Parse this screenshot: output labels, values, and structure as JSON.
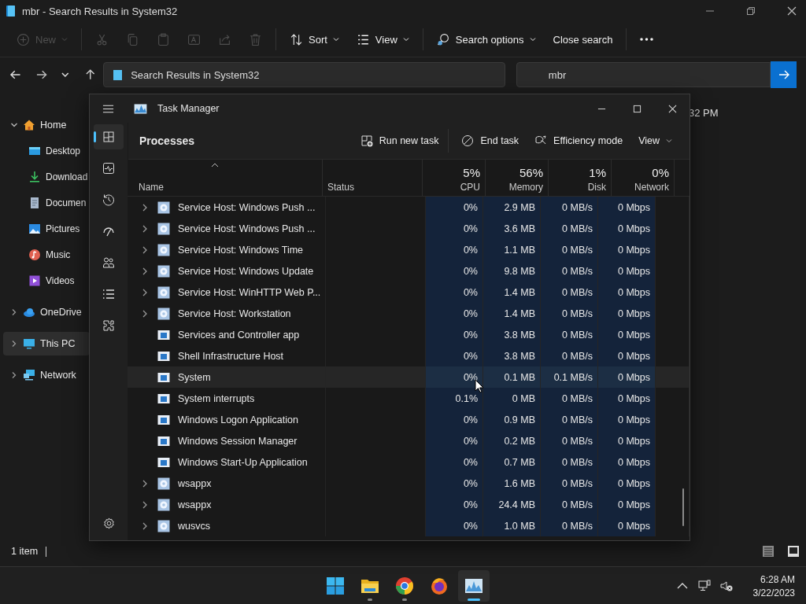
{
  "explorer": {
    "title": "mbr - Search Results in System32",
    "toolbar": [
      {
        "kind": "new",
        "label": "New",
        "disabled": true
      },
      {
        "kind": "cut",
        "disabled": true
      },
      {
        "kind": "copy",
        "disabled": true
      },
      {
        "kind": "paste",
        "disabled": true
      },
      {
        "kind": "rename",
        "disabled": true
      },
      {
        "kind": "share",
        "disabled": true
      },
      {
        "kind": "delete",
        "disabled": true
      },
      {
        "kind": "sort",
        "label": "Sort",
        "disabled": false
      },
      {
        "kind": "view",
        "label": "View",
        "disabled": false
      },
      {
        "kind": "search-options",
        "label": "Search options",
        "disabled": false
      },
      {
        "kind": "close-search",
        "label": "Close search",
        "disabled": false
      },
      {
        "kind": "more",
        "disabled": false
      }
    ],
    "address": "Search Results in System32",
    "search": {
      "value": "mbr"
    },
    "sidebar": [
      {
        "label": "Home",
        "kind": "home",
        "expanded": true,
        "selected": false,
        "children": [
          {
            "label": "Desktop",
            "kind": "desktop",
            "selected": false
          },
          {
            "label": "Download",
            "kind": "downloads",
            "selected": false
          },
          {
            "label": "Documen",
            "kind": "documents",
            "selected": false
          },
          {
            "label": "Pictures",
            "kind": "pictures",
            "selected": false
          },
          {
            "label": "Music",
            "kind": "music",
            "selected": false
          },
          {
            "label": "Videos",
            "kind": "videos",
            "selected": false
          }
        ]
      },
      {
        "label": "OneDrive",
        "kind": "cloud",
        "expanded": false,
        "selected": false
      },
      {
        "label": "This PC",
        "kind": "pc",
        "expanded": false,
        "selected": true
      },
      {
        "label": "Network",
        "kind": "network",
        "expanded": false,
        "selected": false
      }
    ],
    "results_fragment": "32 PM",
    "status": "1 item"
  },
  "task_manager": {
    "title": "Task Manager",
    "nav": [
      {
        "kind": "processes",
        "selected": true
      },
      {
        "kind": "performance",
        "selected": false
      },
      {
        "kind": "history",
        "selected": false
      },
      {
        "kind": "startup",
        "selected": false
      },
      {
        "kind": "users",
        "selected": false
      },
      {
        "kind": "details",
        "selected": false
      },
      {
        "kind": "services",
        "selected": false
      }
    ],
    "page_title": "Processes",
    "actions": [
      {
        "kind": "run",
        "label": "Run new task"
      },
      {
        "kind": "end",
        "label": "End task"
      },
      {
        "kind": "efficiency",
        "label": "Efficiency mode"
      },
      {
        "kind": "view",
        "label": "View"
      }
    ],
    "columns": [
      {
        "label": "Name"
      },
      {
        "label": "Status"
      },
      {
        "label": "CPU",
        "total": "5%"
      },
      {
        "label": "Memory",
        "total": "56%"
      },
      {
        "label": "Disk",
        "total": "1%"
      },
      {
        "label": "Network",
        "total": "0%"
      }
    ],
    "rows": [
      {
        "name": "Service Host: Windows Push ...",
        "kind": "service",
        "expandable": true,
        "selected": false,
        "cpu": "0%",
        "memory": "2.9 MB",
        "disk": "0 MB/s",
        "network": "0 Mbps"
      },
      {
        "name": "Service Host: Windows Push ...",
        "kind": "service",
        "expandable": true,
        "selected": false,
        "cpu": "0%",
        "memory": "3.6 MB",
        "disk": "0 MB/s",
        "network": "0 Mbps"
      },
      {
        "name": "Service Host: Windows Time",
        "kind": "service",
        "expandable": true,
        "selected": false,
        "cpu": "0%",
        "memory": "1.1 MB",
        "disk": "0 MB/s",
        "network": "0 Mbps"
      },
      {
        "name": "Service Host: Windows Update",
        "kind": "service",
        "expandable": true,
        "selected": false,
        "cpu": "0%",
        "memory": "9.8 MB",
        "disk": "0 MB/s",
        "network": "0 Mbps"
      },
      {
        "name": "Service Host: WinHTTP Web P...",
        "kind": "service",
        "expandable": true,
        "selected": false,
        "cpu": "0%",
        "memory": "1.4 MB",
        "disk": "0 MB/s",
        "network": "0 Mbps"
      },
      {
        "name": "Service Host: Workstation",
        "kind": "service",
        "expandable": true,
        "selected": false,
        "cpu": "0%",
        "memory": "1.4 MB",
        "disk": "0 MB/s",
        "network": "0 Mbps"
      },
      {
        "name": "Services and Controller app",
        "kind": "app",
        "expandable": false,
        "selected": false,
        "cpu": "0%",
        "memory": "3.8 MB",
        "disk": "0 MB/s",
        "network": "0 Mbps"
      },
      {
        "name": "Shell Infrastructure Host",
        "kind": "app",
        "expandable": false,
        "selected": false,
        "cpu": "0%",
        "memory": "3.8 MB",
        "disk": "0 MB/s",
        "network": "0 Mbps"
      },
      {
        "name": "System",
        "kind": "app",
        "expandable": false,
        "selected": true,
        "cpu": "0%",
        "memory": "0.1 MB",
        "disk": "0.1 MB/s",
        "network": "0 Mbps"
      },
      {
        "name": "System interrupts",
        "kind": "app",
        "expandable": false,
        "selected": false,
        "cpu": "0.1%",
        "memory": "0 MB",
        "disk": "0 MB/s",
        "network": "0 Mbps"
      },
      {
        "name": "Windows Logon Application",
        "kind": "app",
        "expandable": false,
        "selected": false,
        "cpu": "0%",
        "memory": "0.9 MB",
        "disk": "0 MB/s",
        "network": "0 Mbps"
      },
      {
        "name": "Windows Session Manager",
        "kind": "app",
        "expandable": false,
        "selected": false,
        "cpu": "0%",
        "memory": "0.2 MB",
        "disk": "0 MB/s",
        "network": "0 Mbps"
      },
      {
        "name": "Windows Start-Up Application",
        "kind": "app",
        "expandable": false,
        "selected": false,
        "cpu": "0%",
        "memory": "0.7 MB",
        "disk": "0 MB/s",
        "network": "0 Mbps"
      },
      {
        "name": "wsappx",
        "kind": "service",
        "expandable": true,
        "selected": false,
        "cpu": "0%",
        "memory": "1.6 MB",
        "disk": "0 MB/s",
        "network": "0 Mbps"
      },
      {
        "name": "wsappx",
        "kind": "service",
        "expandable": true,
        "selected": false,
        "cpu": "0%",
        "memory": "24.4 MB",
        "disk": "0 MB/s",
        "network": "0 Mbps"
      },
      {
        "name": "wusvcs",
        "kind": "service",
        "expandable": true,
        "selected": false,
        "cpu": "0%",
        "memory": "1.0 MB",
        "disk": "0 MB/s",
        "network": "0 Mbps"
      }
    ]
  },
  "taskbar": {
    "apps": [
      {
        "kind": "start",
        "running": false,
        "active": false
      },
      {
        "kind": "files",
        "running": true,
        "active": false
      },
      {
        "kind": "chrome",
        "running": true,
        "active": false
      },
      {
        "kind": "firefox",
        "running": false,
        "active": false
      },
      {
        "kind": "taskmanager",
        "running": true,
        "active": true
      }
    ],
    "time": "6:28 AM",
    "date": "3/22/2023"
  }
}
